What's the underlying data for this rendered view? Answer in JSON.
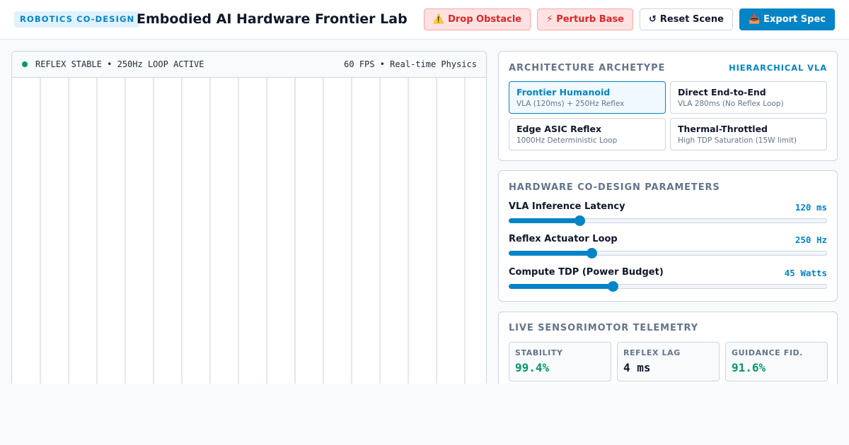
{
  "header": {
    "badge": "ROBOTICS CO-DESIGN",
    "title": "Embodied AI Hardware Frontier Lab",
    "buttons": {
      "drop_obstacle": {
        "label": "Drop Obstacle",
        "icon": "⚠️"
      },
      "perturb_base": {
        "label": "Perturb Base",
        "icon": "⚡"
      },
      "reset_scene": {
        "label": "Reset Scene",
        "icon": "↺"
      },
      "export_spec": {
        "label": "Export Spec",
        "icon": "📥"
      }
    }
  },
  "viewport": {
    "status": "REFLEX STABLE • 250Hz LOOP ACTIVE",
    "fps": "60 FPS • Real-time Physics",
    "status_color": "#059669"
  },
  "architecture": {
    "title": "ARCHITECTURE ARCHETYPE",
    "selected": "HIERARCHICAL VLA",
    "cards": [
      {
        "name": "Frontier Humanoid",
        "desc": "VLA (120ms) + 250Hz Reflex",
        "active": true
      },
      {
        "name": "Direct End-to-End",
        "desc": "VLA 280ms (No Reflex Loop)",
        "active": false
      },
      {
        "name": "Edge ASIC Reflex",
        "desc": "1000Hz Deterministic Loop",
        "active": false
      },
      {
        "name": "Thermal-Throttled",
        "desc": "High TDP Saturation (15W limit)",
        "active": false
      }
    ]
  },
  "params": {
    "title": "HARDWARE CO-DESIGN PARAMETERS",
    "items": [
      {
        "label": "VLA Inference Latency",
        "value": "120 ms",
        "fraction": 0.22
      },
      {
        "label": "Reflex Actuator Loop",
        "value": "250 Hz",
        "fraction": 0.26
      },
      {
        "label": "Compute TDP (Power Budget)",
        "value": "45 Watts",
        "fraction": 0.325
      }
    ]
  },
  "telemetry": {
    "title": "LIVE SENSORIMOTOR TELEMETRY",
    "items": [
      {
        "label": "STABILITY",
        "value": "99.4%",
        "color": "#059669"
      },
      {
        "label": "REFLEX LAG",
        "value": "4 ms",
        "color": "#0f172a"
      },
      {
        "label": "GUIDANCE FID.",
        "value": "91.6%",
        "color": "#059669"
      }
    ]
  },
  "colors": {
    "accent": "#0284c7",
    "warn": "#dc2626",
    "ok": "#059669"
  }
}
